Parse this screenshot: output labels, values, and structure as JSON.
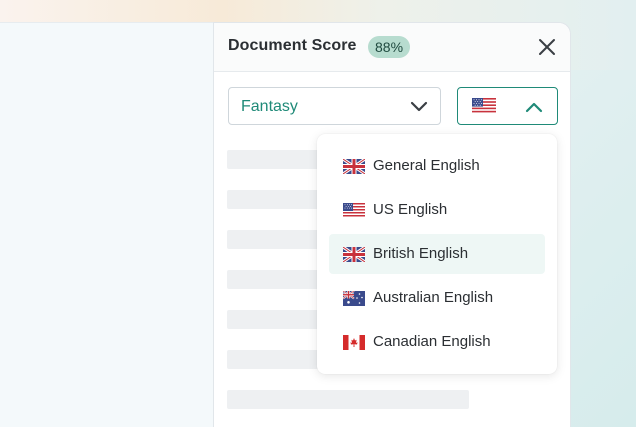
{
  "panel": {
    "title": "Document Score",
    "score": "88%"
  },
  "genre_select": {
    "value": "Fantasy",
    "icon": "chevron-down-icon"
  },
  "language_select": {
    "selected_flag": "us-flag-icon",
    "icon": "chevron-up-icon",
    "expanded": true
  },
  "language_menu": {
    "options": [
      {
        "label": "General English",
        "flag": "uk-flag-icon"
      },
      {
        "label": "US English",
        "flag": "us-flag-icon"
      },
      {
        "label": "British English",
        "flag": "uk-flag-icon",
        "selected": true
      },
      {
        "label": "Australian English",
        "flag": "australia-flag-icon"
      },
      {
        "label": "Canadian English",
        "flag": "canada-flag-icon"
      }
    ]
  },
  "colors": {
    "accent": "#1f8a78",
    "badge_bg": "#b7dccf",
    "selected_bg": "#eef7f5",
    "skeleton": "#eef0f2"
  }
}
